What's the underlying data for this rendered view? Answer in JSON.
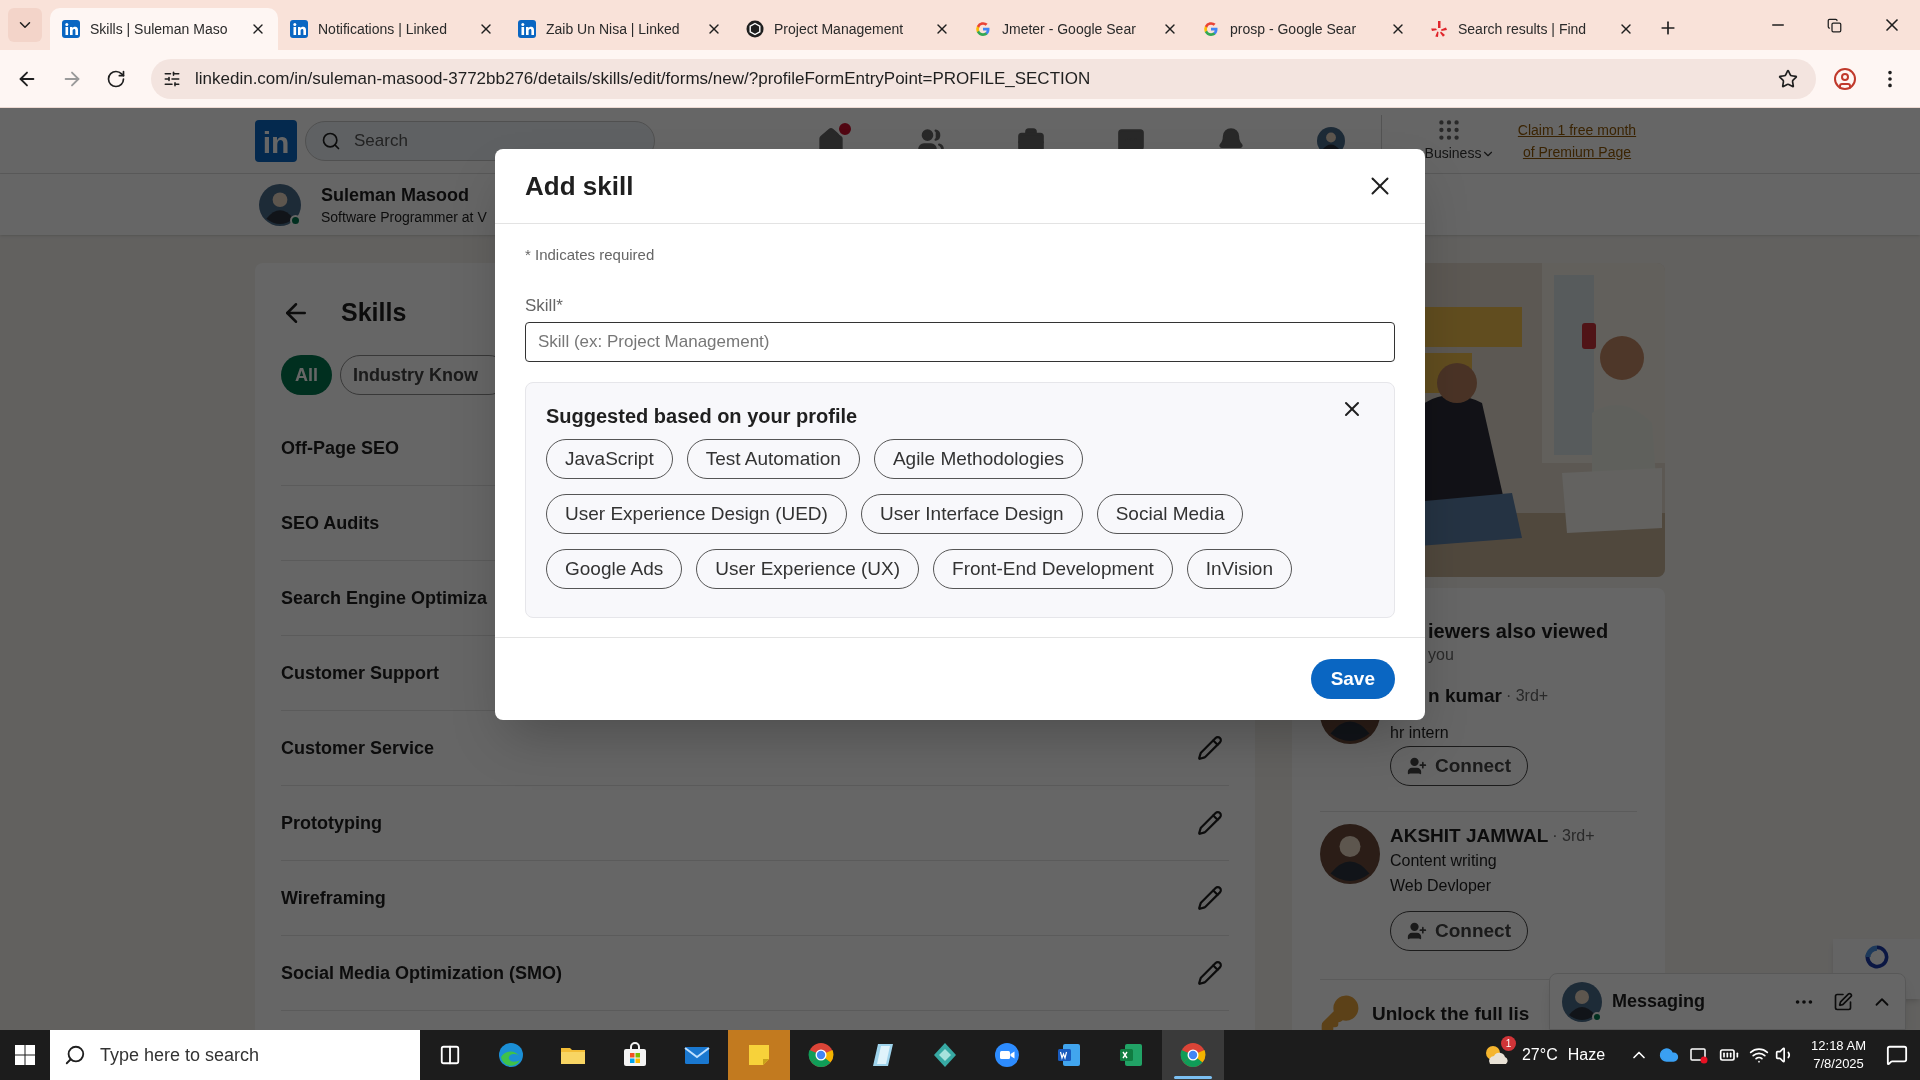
{
  "browser": {
    "tabs": [
      {
        "kind": "linkedin",
        "title": "Skills | Suleman Maso",
        "selected": true
      },
      {
        "kind": "linkedin",
        "title": "Notifications | Linked",
        "selected": false
      },
      {
        "kind": "linkedin",
        "title": "Zaib Un Nisa | Linked",
        "selected": false
      },
      {
        "kind": "chatgpt",
        "title": "Project Management",
        "selected": false
      },
      {
        "kind": "google",
        "title": "Jmeter - Google Sear",
        "selected": false
      },
      {
        "kind": "google",
        "title": "prosp - Google Sear",
        "selected": false
      },
      {
        "kind": "yelp",
        "title": "Search results | Find",
        "selected": false
      }
    ],
    "url": "linkedin.com/in/suleman-masood-3772bb276/details/skills/edit/forms/new/?profileFormEntryPoint=PROFILE_SECTION"
  },
  "header": {
    "logo": "in",
    "search": {
      "placeholder": "Search"
    },
    "nav": [
      {
        "kind": "home",
        "badge": true
      },
      {
        "kind": "network",
        "badge": false
      },
      {
        "kind": "jobs",
        "badge": false
      },
      {
        "kind": "messaging",
        "badge": false
      },
      {
        "kind": "notifications",
        "badge": false
      },
      {
        "kind": "me",
        "badge": false
      }
    ],
    "business": "Business",
    "premium_link": "Claim 1 free month of Premium Page"
  },
  "profile_bar": {
    "name": "Suleman Masood",
    "headline": "Software Programmer at V",
    "online": true
  },
  "skills": {
    "title": "Skills",
    "filters": [
      {
        "label": "All",
        "selected": true
      },
      {
        "label": "Industry Know",
        "selected": false
      }
    ],
    "items": [
      {
        "name": "Off-Page SEO",
        "edit_icon": false
      },
      {
        "name": "SEO Audits",
        "edit_icon": false
      },
      {
        "name": "Search Engine Optimiza",
        "edit_icon": false
      },
      {
        "name": "Customer Support",
        "edit_icon": false
      },
      {
        "name": "Customer Service",
        "edit_icon": true
      },
      {
        "name": "Prototyping",
        "edit_icon": true
      },
      {
        "name": "Wireframing",
        "edit_icon": true
      },
      {
        "name": "Social Media Optimization (SMO)",
        "edit_icon": true
      }
    ]
  },
  "people_card": {
    "title": "iewers also viewed",
    "subtitle": "you",
    "people": [
      {
        "name": "n kumar",
        "degree": "· 3rd+",
        "lines": [
          "hr intern"
        ],
        "action": "Connect"
      },
      {
        "name": "AKSHIT JAMWAL",
        "degree": "· 3rd+",
        "lines": [
          "Content writing",
          "Web Devloper"
        ],
        "action": "Connect"
      }
    ],
    "unlock": "Unlock the full lis"
  },
  "messaging": {
    "title": "Messaging",
    "online": true
  },
  "modal": {
    "title": "Add skill",
    "required_note": "* Indicates required",
    "field": {
      "label": "Skill*",
      "placeholder": "Skill (ex: Project Management)"
    },
    "suggestions": {
      "title": "Suggested based on your profile",
      "chips": [
        "JavaScript",
        "Test Automation",
        "Agile Methodologies",
        "User Experience Design (UED)",
        "User Interface Design",
        "Social Media",
        "Google Ads",
        "User Experience (UX)",
        "Front-End Development",
        "InVision"
      ]
    },
    "save": "Save"
  },
  "taskbar": {
    "search_placeholder": "Type here to search",
    "apps": [
      {
        "kind": "edge",
        "flashing": false,
        "selected": false
      },
      {
        "kind": "explorer",
        "flashing": false,
        "selected": false
      },
      {
        "kind": "store",
        "flashing": false,
        "selected": false
      },
      {
        "kind": "mail",
        "flashing": false,
        "selected": false
      },
      {
        "kind": "sticky",
        "flashing": true,
        "selected": false
      },
      {
        "kind": "chrome",
        "flashing": false,
        "selected": false
      },
      {
        "kind": "glass",
        "flashing": false,
        "selected": false
      },
      {
        "kind": "diamond",
        "flashing": false,
        "selected": false
      },
      {
        "kind": "zoom",
        "flashing": false,
        "selected": false
      },
      {
        "kind": "word",
        "flashing": false,
        "selected": false
      },
      {
        "kind": "excel",
        "flashing": false,
        "selected": false
      },
      {
        "kind": "chrome",
        "flashing": false,
        "selected": true
      }
    ],
    "weather": {
      "badge": "1",
      "temperature": "27°C",
      "condition": "Haze"
    },
    "time": "12:18 AM",
    "date": "7/8/2025"
  }
}
